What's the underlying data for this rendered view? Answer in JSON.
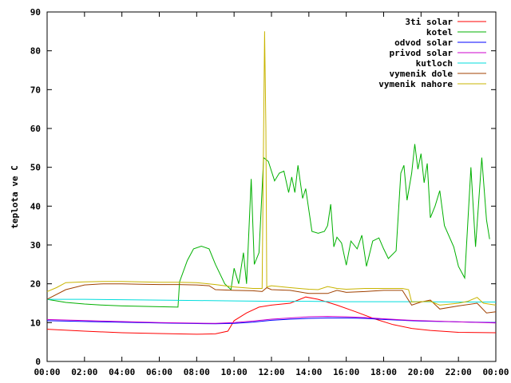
{
  "chart_data": {
    "type": "line",
    "title": "",
    "xlabel": "",
    "ylabel": "teplota ve C",
    "ylim": [
      0,
      90
    ],
    "xlim": [
      "00:00",
      "24:00"
    ],
    "x_ticks": [
      "00:00",
      "02:00",
      "04:00",
      "06:00",
      "08:00",
      "10:00",
      "12:00",
      "14:00",
      "16:00",
      "18:00",
      "20:00",
      "22:00",
      "00:00"
    ],
    "y_ticks": [
      "0",
      "10",
      "20",
      "30",
      "40",
      "50",
      "60",
      "70",
      "80",
      "90"
    ],
    "grid": false,
    "legend_position": "top-right",
    "series": [
      {
        "name": "3ti solar",
        "color": "#ff0000",
        "points": [
          [
            "00:00",
            8.3
          ],
          [
            "02:00",
            7.8
          ],
          [
            "04:00",
            7.4
          ],
          [
            "06:00",
            7.2
          ],
          [
            "08:00",
            7.0
          ],
          [
            "09:00",
            7.1
          ],
          [
            "09:40",
            7.8
          ],
          [
            "10:00",
            10.5
          ],
          [
            "10:40",
            12.5
          ],
          [
            "11:20",
            14.0
          ],
          [
            "12:00",
            14.5
          ],
          [
            "13:00",
            15.0
          ],
          [
            "13:50",
            16.6
          ],
          [
            "14:30",
            16.0
          ],
          [
            "15:30",
            14.5
          ],
          [
            "16:30",
            12.8
          ],
          [
            "17:30",
            11.0
          ],
          [
            "18:30",
            9.5
          ],
          [
            "19:30",
            8.5
          ],
          [
            "20:30",
            8.0
          ],
          [
            "22:00",
            7.5
          ],
          [
            "24:00",
            7.4
          ]
        ]
      },
      {
        "name": "kotel",
        "color": "#00b000",
        "points": [
          [
            "00:00",
            16.0
          ],
          [
            "01:00",
            15.2
          ],
          [
            "02:00",
            14.8
          ],
          [
            "03:00",
            14.5
          ],
          [
            "04:00",
            14.3
          ],
          [
            "05:00",
            14.2
          ],
          [
            "06:00",
            14.1
          ],
          [
            "07:00",
            14.0
          ],
          [
            "07:05",
            20.5
          ],
          [
            "07:30",
            26.0
          ],
          [
            "07:50",
            29.0
          ],
          [
            "08:15",
            29.7
          ],
          [
            "08:40",
            29.0
          ],
          [
            "09:00",
            25.0
          ],
          [
            "09:30",
            20.0
          ],
          [
            "09:50",
            18.5
          ],
          [
            "10:00",
            24.0
          ],
          [
            "10:15",
            20.0
          ],
          [
            "10:30",
            28.0
          ],
          [
            "10:40",
            20.0
          ],
          [
            "10:55",
            47.0
          ],
          [
            "11:05",
            25.0
          ],
          [
            "11:20",
            28.0
          ],
          [
            "11:35",
            52.5
          ],
          [
            "11:50",
            51.5
          ],
          [
            "12:10",
            46.5
          ],
          [
            "12:25",
            48.5
          ],
          [
            "12:40",
            49.0
          ],
          [
            "12:55",
            43.5
          ],
          [
            "13:05",
            47.5
          ],
          [
            "13:15",
            43.5
          ],
          [
            "13:25",
            50.5
          ],
          [
            "13:40",
            42.0
          ],
          [
            "13:50",
            44.5
          ],
          [
            "14:00",
            39.0
          ],
          [
            "14:10",
            33.5
          ],
          [
            "14:30",
            33.0
          ],
          [
            "14:50",
            33.5
          ],
          [
            "15:00",
            35.0
          ],
          [
            "15:10",
            40.5
          ],
          [
            "15:20",
            29.5
          ],
          [
            "15:30",
            32.0
          ],
          [
            "15:45",
            30.5
          ],
          [
            "16:00",
            24.8
          ],
          [
            "16:15",
            31.0
          ],
          [
            "16:35",
            29.0
          ],
          [
            "16:50",
            32.5
          ],
          [
            "17:05",
            24.5
          ],
          [
            "17:25",
            31.0
          ],
          [
            "17:45",
            31.8
          ],
          [
            "18:00",
            29.0
          ],
          [
            "18:15",
            26.5
          ],
          [
            "18:40",
            28.5
          ],
          [
            "18:55",
            48.5
          ],
          [
            "19:05",
            50.5
          ],
          [
            "19:15",
            41.5
          ],
          [
            "19:30",
            48.5
          ],
          [
            "19:40",
            56.0
          ],
          [
            "19:50",
            49.5
          ],
          [
            "20:00",
            53.5
          ],
          [
            "20:10",
            46.0
          ],
          [
            "20:20",
            51.0
          ],
          [
            "20:30",
            37.0
          ],
          [
            "20:45",
            40.0
          ],
          [
            "21:00",
            44.0
          ],
          [
            "21:15",
            35.0
          ],
          [
            "21:45",
            29.5
          ],
          [
            "22:00",
            24.5
          ],
          [
            "22:20",
            21.5
          ],
          [
            "22:40",
            50.0
          ],
          [
            "22:55",
            29.5
          ],
          [
            "23:15",
            52.5
          ],
          [
            "23:30",
            36.5
          ],
          [
            "23:40",
            31.5
          ]
        ]
      },
      {
        "name": "odvod solar",
        "color": "#0000ff",
        "points": [
          [
            "00:00",
            10.5
          ],
          [
            "03:00",
            10.2
          ],
          [
            "06:00",
            9.9
          ],
          [
            "09:00",
            9.7
          ],
          [
            "10:00",
            9.8
          ],
          [
            "11:00",
            10.1
          ],
          [
            "12:00",
            10.6
          ],
          [
            "13:00",
            10.9
          ],
          [
            "14:00",
            11.1
          ],
          [
            "15:00",
            11.2
          ],
          [
            "16:00",
            11.2
          ],
          [
            "17:00",
            11.1
          ],
          [
            "18:00",
            10.8
          ],
          [
            "19:00",
            10.6
          ],
          [
            "20:00",
            10.4
          ],
          [
            "22:00",
            10.2
          ],
          [
            "24:00",
            10.0
          ]
        ]
      },
      {
        "name": "privod solar",
        "color": "#cc00cc",
        "points": [
          [
            "00:00",
            10.8
          ],
          [
            "03:00",
            10.4
          ],
          [
            "06:00",
            10.0
          ],
          [
            "09:00",
            9.8
          ],
          [
            "10:00",
            10.0
          ],
          [
            "11:00",
            10.4
          ],
          [
            "12:00",
            10.9
          ],
          [
            "13:00",
            11.2
          ],
          [
            "14:00",
            11.5
          ],
          [
            "15:00",
            11.6
          ],
          [
            "16:00",
            11.5
          ],
          [
            "17:00",
            11.3
          ],
          [
            "18:00",
            11.0
          ],
          [
            "19:00",
            10.7
          ],
          [
            "20:00",
            10.5
          ],
          [
            "22:00",
            10.2
          ],
          [
            "24:00",
            9.9
          ]
        ]
      },
      {
        "name": "kutloch",
        "color": "#00dddd",
        "points": [
          [
            "00:00",
            16.0
          ],
          [
            "02:00",
            16.0
          ],
          [
            "04:00",
            15.9
          ],
          [
            "06:00",
            15.8
          ],
          [
            "08:00",
            15.7
          ],
          [
            "10:00",
            15.6
          ],
          [
            "12:00",
            15.5
          ],
          [
            "14:00",
            15.5
          ],
          [
            "16:00",
            15.4
          ],
          [
            "18:00",
            15.4
          ],
          [
            "20:00",
            15.4
          ],
          [
            "22:00",
            15.3
          ],
          [
            "24:00",
            15.3
          ]
        ]
      },
      {
        "name": "vymenik dole",
        "color": "#a04000",
        "points": [
          [
            "00:00",
            16.0
          ],
          [
            "01:00",
            18.5
          ],
          [
            "02:00",
            19.7
          ],
          [
            "03:00",
            20.0
          ],
          [
            "04:00",
            20.0
          ],
          [
            "05:00",
            19.9
          ],
          [
            "06:00",
            19.8
          ],
          [
            "07:00",
            19.8
          ],
          [
            "08:00",
            19.7
          ],
          [
            "08:40",
            19.5
          ],
          [
            "09:00",
            18.5
          ],
          [
            "10:00",
            18.3
          ],
          [
            "11:00",
            18.2
          ],
          [
            "11:30",
            18.0
          ],
          [
            "11:45",
            19.0
          ],
          [
            "12:00",
            18.5
          ],
          [
            "13:00",
            18.3
          ],
          [
            "14:00",
            17.5
          ],
          [
            "15:00",
            17.5
          ],
          [
            "15:30",
            18.3
          ],
          [
            "16:00",
            17.8
          ],
          [
            "17:00",
            18.0
          ],
          [
            "18:00",
            18.3
          ],
          [
            "19:00",
            18.3
          ],
          [
            "19:30",
            14.5
          ],
          [
            "20:00",
            15.3
          ],
          [
            "20:30",
            15.8
          ],
          [
            "21:00",
            13.5
          ],
          [
            "22:00",
            14.3
          ],
          [
            "23:00",
            15.0
          ],
          [
            "23:30",
            12.5
          ],
          [
            "24:00",
            12.8
          ]
        ]
      },
      {
        "name": "vymenik nahore",
        "color": "#c8b400",
        "points": [
          [
            "00:00",
            18.0
          ],
          [
            "00:30",
            19.0
          ],
          [
            "01:00",
            20.3
          ],
          [
            "02:00",
            20.5
          ],
          [
            "03:00",
            20.6
          ],
          [
            "04:00",
            20.6
          ],
          [
            "05:00",
            20.5
          ],
          [
            "06:00",
            20.4
          ],
          [
            "07:00",
            20.4
          ],
          [
            "08:00",
            20.3
          ],
          [
            "09:00",
            19.8
          ],
          [
            "10:00",
            19.2
          ],
          [
            "11:00",
            18.8
          ],
          [
            "11:30",
            18.8
          ],
          [
            "11:35",
            60.0
          ],
          [
            "11:38",
            85.0
          ],
          [
            "11:42",
            60.0
          ],
          [
            "11:45",
            19.2
          ],
          [
            "12:00",
            19.5
          ],
          [
            "13:00",
            19.0
          ],
          [
            "14:00",
            18.6
          ],
          [
            "14:30",
            18.5
          ],
          [
            "15:00",
            19.3
          ],
          [
            "15:30",
            18.8
          ],
          [
            "16:00",
            18.6
          ],
          [
            "17:00",
            18.8
          ],
          [
            "18:00",
            18.8
          ],
          [
            "19:00",
            18.8
          ],
          [
            "19:20",
            18.5
          ],
          [
            "19:30",
            15.3
          ],
          [
            "20:30",
            15.5
          ],
          [
            "21:00",
            14.5
          ],
          [
            "22:00",
            15.0
          ],
          [
            "22:30",
            15.5
          ],
          [
            "23:00",
            16.5
          ],
          [
            "23:20",
            15.0
          ],
          [
            "24:00",
            14.5
          ]
        ]
      }
    ]
  }
}
